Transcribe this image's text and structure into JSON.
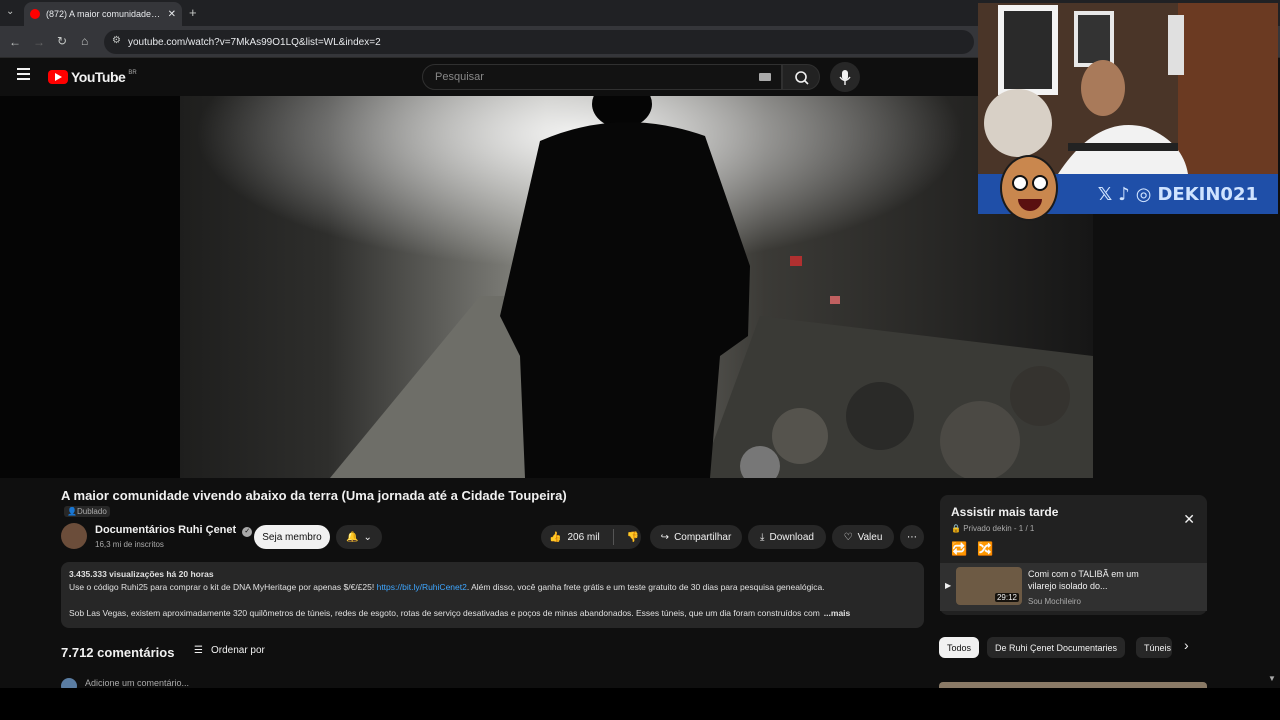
{
  "browser": {
    "tab_title": "(872) A maior comunidade viven",
    "new_tab": "+",
    "url": "youtube.com/watch?v=7MkAs99O1LQ&list=WL&index=2"
  },
  "youtube": {
    "logo_text": "YouTube",
    "region": "BR",
    "search_placeholder": "Pesquisar"
  },
  "webcam": {
    "social_handle": "DEKIN021"
  },
  "video": {
    "title": "A maior comunidade vivendo abaixo da terra (Uma jornada até a Cidade Toupeira)",
    "dubbed_badge": "Dublado",
    "channel_name": "Documentários Ruhi Çenet",
    "subscribers": "16,3 mi de inscritos",
    "member_button": "Seja membro",
    "likes": "206 mil",
    "share": "Compartilhar",
    "download": "Download",
    "thanks": "Valeu"
  },
  "description": {
    "stats": "3.435.333 visualizações  há 20 horas",
    "line1_a": "Use o código Ruhi25 para comprar o kit de DNA MyHeritage por apenas $/€/£25! ",
    "line1_link": "https://bit.ly/RuhiCenet2",
    "line1_b": ". Além disso, você ganha frete grátis e um teste gratuito de 30 dias para pesquisa genealógica.",
    "line2": "Sob Las Vegas, existem aproximadamente 320 quilômetros de túneis, redes de esgoto, rotas de serviço desativadas e poços de minas abandonados. Esses túneis, que um dia foram construídos com",
    "more": "...mais"
  },
  "comments": {
    "count": "7.712 comentários",
    "sort_label": "Ordenar por",
    "add_placeholder": "Adicione um comentário..."
  },
  "playlist": {
    "title": "Assistir mais tarde",
    "meta": "Privado  dekin - 1 / 1",
    "item_title": "Comi com o TALIBÃ em um vilarejo isolado do...",
    "item_duration": "29:12",
    "item_channel": "Sou Mochileiro"
  },
  "chips": {
    "all": "Todos",
    "ruhi": "De Ruhi Çenet Documentaries",
    "tuneis": "Túneis"
  },
  "colors": {
    "background": "#0f0f0f",
    "accent_red": "#ff0000",
    "link_blue": "#3ea6ff",
    "webcam_bar": "#1f4fa8"
  }
}
